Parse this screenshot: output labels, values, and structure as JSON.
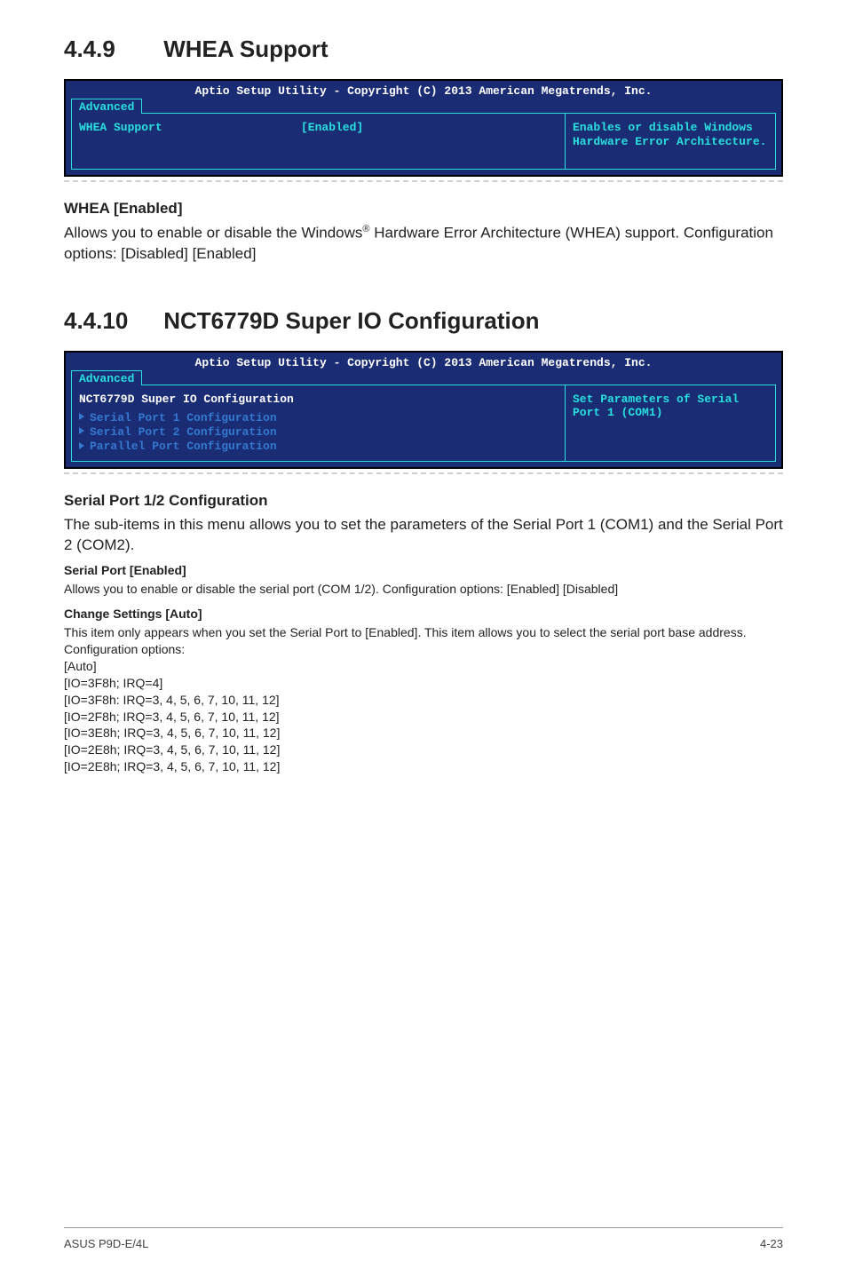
{
  "section_449": {
    "number": "4.4.9",
    "title": "WHEA Support",
    "bios": {
      "title": "Aptio Setup Utility - Copyright (C) 2013 American Megatrends, Inc.",
      "tab": "Advanced",
      "left_label": "WHEA Support",
      "left_value": "[Enabled]",
      "right_help": "Enables or disable Windows Hardware Error Architecture."
    },
    "heading": "WHEA [Enabled]",
    "paragraph_pre": "Allows you to enable or disable the Windows",
    "paragraph_sup": "®",
    "paragraph_post": " Hardware Error Architecture (WHEA) support. Configuration options: [Disabled] [Enabled]"
  },
  "section_4410": {
    "number": "4.4.10",
    "title": "NCT6779D Super IO Configuration",
    "bios": {
      "title": "Aptio Setup Utility - Copyright (C) 2013 American Megatrends, Inc.",
      "tab": "Advanced",
      "header_line": "NCT6779D Super IO Configuration",
      "item1": "Serial Port 1 Configuration",
      "item2": "Serial Port 2 Configuration",
      "item3": "Parallel Port Configuration",
      "right_help": "Set Parameters of Serial Port 1 (COM1)"
    },
    "sub1": {
      "heading": "Serial Port 1/2 Configuration",
      "paragraph": "The sub-items in this menu allows you to set the parameters of the Serial Port 1 (COM1) and the Serial Port 2 (COM2)."
    },
    "serial_port": {
      "heading": "Serial Port [Enabled]",
      "paragraph": "Allows you to enable or disable the serial port (COM 1/2). Configuration options: [Enabled] [Disabled]"
    },
    "change_settings": {
      "heading": "Change Settings [Auto]",
      "paragraph": "This item only appears when you set the Serial Port to [Enabled]. This item allows you to select the serial port base address. Configuration options:",
      "opts": [
        "[Auto]",
        "[IO=3F8h; IRQ=4]",
        "[IO=3F8h: IRQ=3, 4, 5, 6, 7, 10, 11, 12]",
        "[IO=2F8h; IRQ=3, 4, 5, 6, 7, 10, 11, 12]",
        "[IO=3E8h; IRQ=3, 4, 5, 6, 7, 10, 11, 12]",
        "[IO=2E8h; IRQ=3, 4, 5, 6, 7, 10, 11, 12]",
        "[IO=2E8h; IRQ=3, 4, 5, 6, 7, 10, 11, 12]"
      ]
    }
  },
  "footer": {
    "left": "ASUS P9D-E/4L",
    "right": "4-23"
  }
}
